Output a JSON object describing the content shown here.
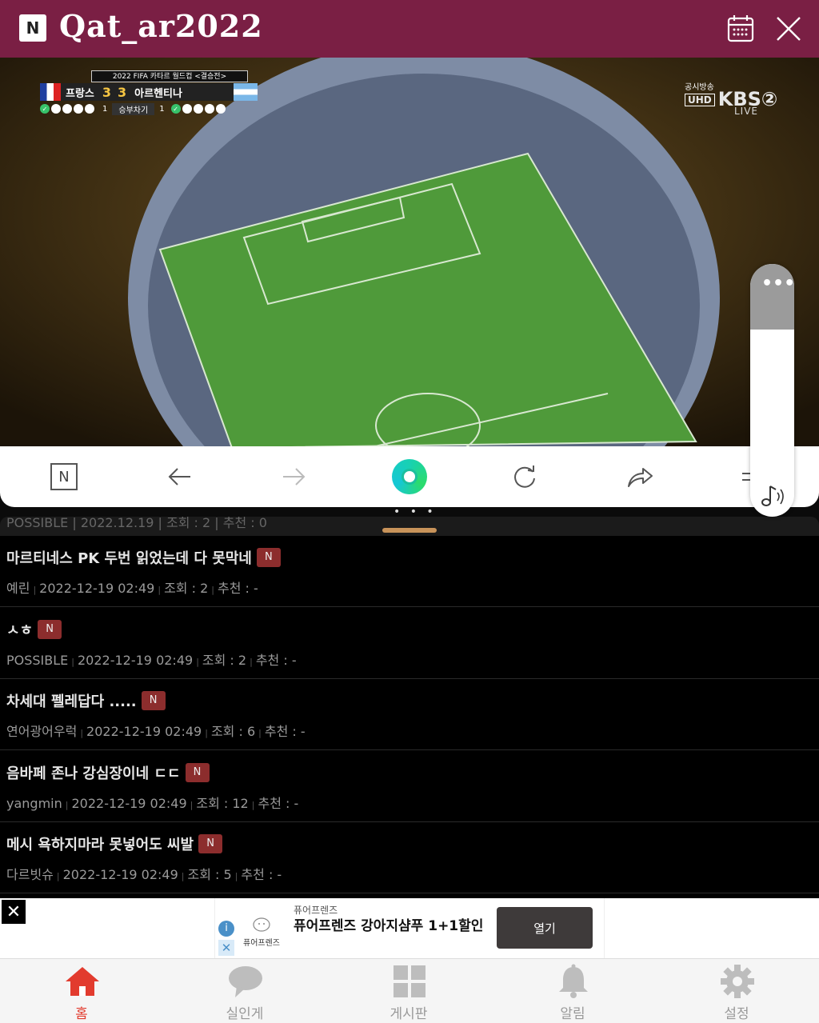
{
  "header": {
    "logo_letter": "N",
    "title": "Qat_ar2022"
  },
  "video": {
    "score_caption": "2022 FIFA 카타르 월드컵 <결승전>",
    "team_home": "프랑스",
    "score_home": "3",
    "score_away": "3",
    "team_away": "아르헨티나",
    "pk_home": "1",
    "pk_label": "승부차기",
    "pk_away": "1",
    "broadcaster_label": "공시방송",
    "uhd_label": "UHD",
    "channel": "KBS②",
    "live_label": "LIVE"
  },
  "toolbar": {
    "n_label": "N"
  },
  "side_panel": {
    "dots": "•••"
  },
  "pager": "• • •",
  "list": {
    "cut_row": "POSSIBLE | 2022.12.19 | 조회 : 2 | 추천 : 0",
    "posts": [
      {
        "title": "마르티네스 PK 두번 읽었는데 다 못막네",
        "badge": "N",
        "author": "예린",
        "date": "2022-12-19 02:49",
        "views": "조회 : 2",
        "likes": "추천 : -"
      },
      {
        "title": "ㅅㅎ",
        "badge": "N",
        "author": "POSSIBLE",
        "date": "2022-12-19 02:49",
        "views": "조회 : 2",
        "likes": "추천 : -"
      },
      {
        "title": "차세대 펠레답다 .....",
        "badge": "N",
        "author": "연어광어우럭",
        "date": "2022-12-19 02:49",
        "views": "조회 : 6",
        "likes": "추천 : -"
      },
      {
        "title": "음바페 존나 강심장이네 ㄷㄷ",
        "badge": "N",
        "author": "yangmin",
        "date": "2022-12-19 02:49",
        "views": "조회 : 12",
        "likes": "추천 : -"
      },
      {
        "title": "메시 욕하지마라 못넣어도 씨발",
        "badge": "N",
        "author": "다르빗슈",
        "date": "2022-12-19 02:49",
        "views": "조회 : 5",
        "likes": "추천 : -"
      }
    ]
  },
  "ad": {
    "close": "✕",
    "logo_text": "퓨어프렌즈",
    "brand": "퓨어프렌즈",
    "title": "퓨어프렌즈 강아지샴푸 1+1할인",
    "cta": "열기"
  },
  "bottom_nav": {
    "items": [
      {
        "label": "홈",
        "icon": "home-icon"
      },
      {
        "label": "실인게",
        "icon": "chat-icon"
      },
      {
        "label": "게시판",
        "icon": "grid-icon"
      },
      {
        "label": "알림",
        "icon": "bell-icon"
      },
      {
        "label": "설정",
        "icon": "gear-icon"
      }
    ]
  },
  "colors": {
    "header_bg": "#7a1f44",
    "badge_bg": "#8c2d2d",
    "nav_active": "#e23b2e",
    "pitch": "#4f9a3a"
  }
}
